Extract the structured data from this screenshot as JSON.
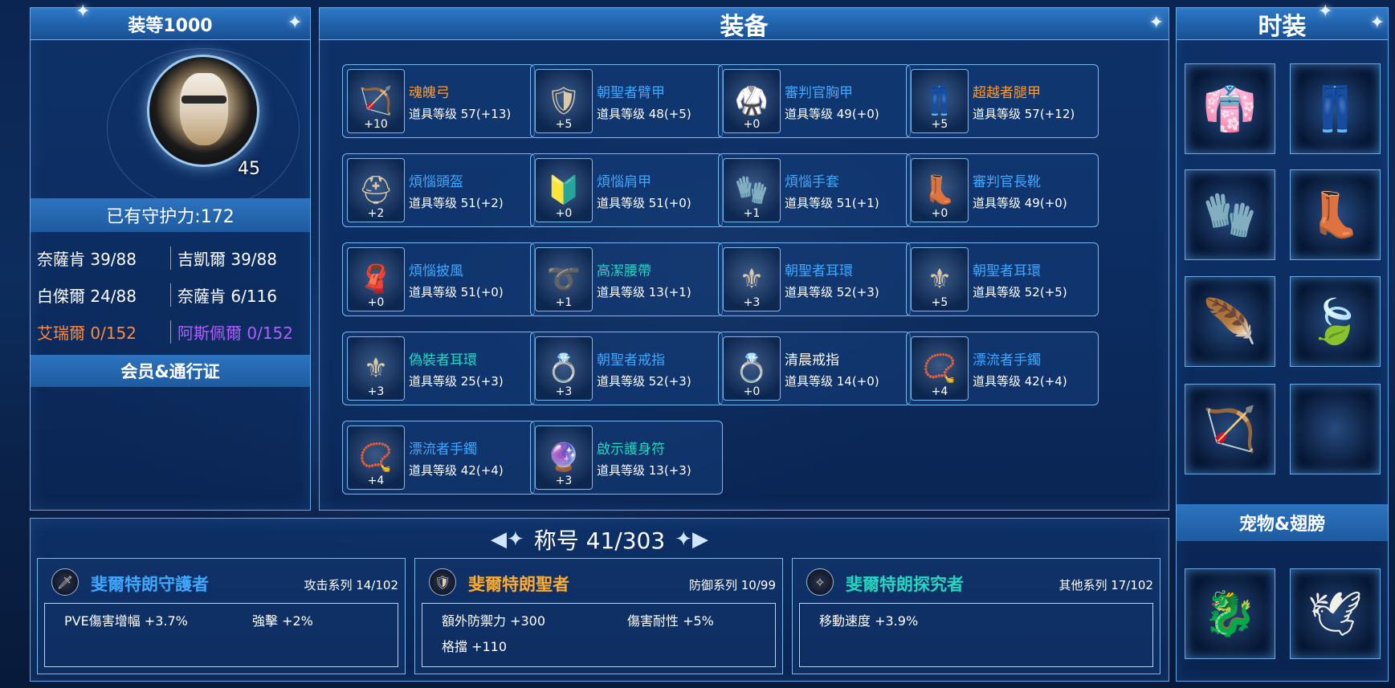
{
  "profile": {
    "item_level": "装等1000",
    "level": "45",
    "guard_power": "已有守护力:172",
    "stats": [
      {
        "left": "奈薩肯 39/88",
        "right": "吉凱爾 39/88"
      },
      {
        "left": "白傑爾 24/88",
        "right": "奈薩肯 6/116"
      },
      {
        "left": "艾瑞爾 0/152",
        "right": "阿斯佩爾 0/152"
      }
    ],
    "member_pass": "会员&通行证"
  },
  "equipment": {
    "title": "装备",
    "slots": [
      {
        "name": "魂魄弓",
        "level": "道具等级 57(+13)",
        "plus": "+10",
        "color": "#ff9a2e",
        "icon": "bow-icon"
      },
      {
        "name": "朝聖者臂甲",
        "level": "道具等级 48(+5)",
        "plus": "+5",
        "color": "#3ea8ff",
        "icon": "armguard-icon"
      },
      {
        "name": "審判官胸甲",
        "level": "道具等级 49(+0)",
        "plus": "+0",
        "color": "#3ea8ff",
        "icon": "chest-armor-icon"
      },
      {
        "name": "超越者腿甲",
        "level": "道具等级 57(+12)",
        "plus": "+5",
        "color": "#ff9a2e",
        "icon": "leg-armor-icon"
      },
      {
        "name": "煩惱頭盔",
        "level": "道具等级 51(+2)",
        "plus": "+2",
        "color": "#3ea8ff",
        "icon": "helmet-icon"
      },
      {
        "name": "煩惱肩甲",
        "level": "道具等级 51(+0)",
        "plus": "+0",
        "color": "#3ea8ff",
        "icon": "shoulder-armor-icon"
      },
      {
        "name": "煩惱手套",
        "level": "道具等级 51(+1)",
        "plus": "+1",
        "color": "#3ea8ff",
        "icon": "gloves-icon"
      },
      {
        "name": "審判官長靴",
        "level": "道具等级 49(+0)",
        "plus": "+0",
        "color": "#3ea8ff",
        "icon": "boots-icon"
      },
      {
        "name": "煩惱披風",
        "level": "道具等级 51(+0)",
        "plus": "+0",
        "color": "#3ea8ff",
        "icon": "cape-icon"
      },
      {
        "name": "高潔腰帶",
        "level": "道具等级 13(+1)",
        "plus": "+1",
        "color": "#25d6c2",
        "icon": "belt-icon"
      },
      {
        "name": "朝聖者耳環",
        "level": "道具等级 52(+3)",
        "plus": "+3",
        "color": "#3ea8ff",
        "icon": "earring-icon"
      },
      {
        "name": "朝聖者耳環",
        "level": "道具等级 52(+5)",
        "plus": "+5",
        "color": "#3ea8ff",
        "icon": "earring-icon"
      },
      {
        "name": "偽裝者耳環",
        "level": "道具等级 25(+3)",
        "plus": "+3",
        "color": "#25d6c2",
        "icon": "earring-icon"
      },
      {
        "name": "朝聖者戒指",
        "level": "道具等级 52(+3)",
        "plus": "+3",
        "color": "#3ea8ff",
        "icon": "ring-icon"
      },
      {
        "name": "清晨戒指",
        "level": "道具等级 14(+0)",
        "plus": "+0",
        "color": "#ffffff",
        "icon": "ring-icon"
      },
      {
        "name": "漂流者手鐲",
        "level": "道具等级 42(+4)",
        "plus": "+4",
        "color": "#3ea8ff",
        "icon": "bracelet-icon"
      },
      {
        "name": "漂流者手鐲",
        "level": "道具等级 42(+4)",
        "plus": "+4",
        "color": "#3ea8ff",
        "icon": "bracelet-icon"
      },
      {
        "name": "啟示護身符",
        "level": "道具等级 13(+3)",
        "plus": "+3",
        "color": "#25d6c2",
        "icon": "amulet-icon"
      }
    ]
  },
  "fashion": {
    "title": "时装",
    "slots": [
      "fashion-chest-icon",
      "fashion-pants-icon",
      "fashion-gloves-icon",
      "fashion-boots-icon",
      "fashion-wing-accessory-icon",
      "fashion-feather-accessory-icon",
      "fashion-weapon-icon",
      "empty"
    ],
    "pet_wings": "宠物&翅膀",
    "pet_slots": [
      "pet-icon",
      "wings-icon"
    ]
  },
  "titles": {
    "header": "称号 41/303",
    "cards": [
      {
        "name": "斐爾特朗守護者",
        "series": "攻击系列 14/102",
        "color": "#3ea8ff",
        "icon": "sword-emblem-icon",
        "effects": [
          "PVE傷害增幅 +3.7%",
          "強擊 +2%"
        ]
      },
      {
        "name": "斐爾特朗聖者",
        "series": "防御系列 10/99",
        "color": "#ffab2e",
        "icon": "shield-emblem-icon",
        "effects": [
          "額外防禦力 +300",
          "傷害耐性 +5%",
          "格擋 +110"
        ]
      },
      {
        "name": "斐爾特朗探究者",
        "series": "其他系列 17/102",
        "color": "#25d6c2",
        "icon": "star-emblem-icon",
        "effects": [
          "移動速度 +3.9%"
        ]
      }
    ]
  }
}
